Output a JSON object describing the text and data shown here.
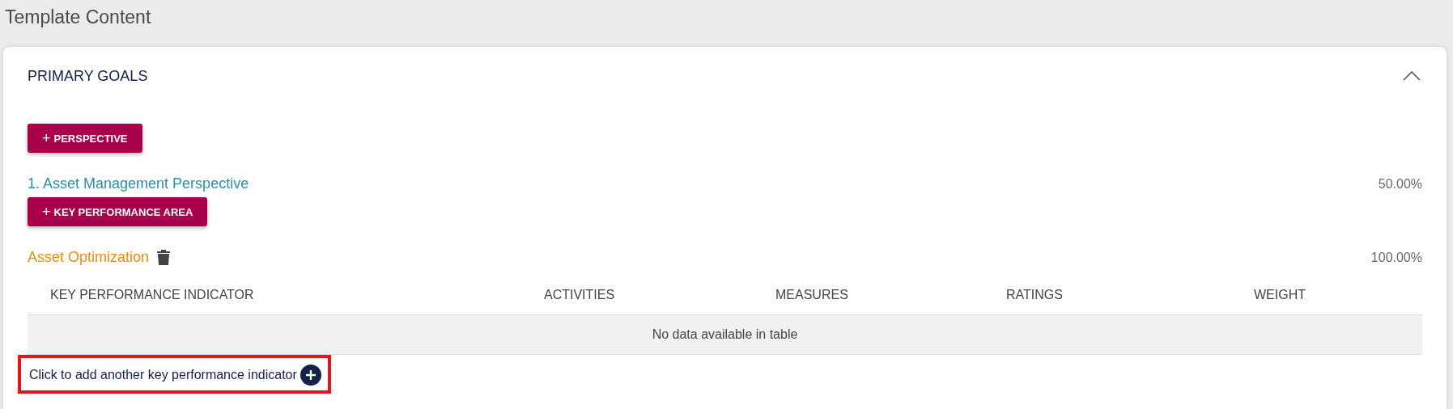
{
  "page_title": "Template Content",
  "section": {
    "title": "PRIMARY GOALS",
    "expanded": true,
    "add_perspective": {
      "icon": "+",
      "label": "PERSPECTIVE"
    },
    "perspective": {
      "title": "1. Asset Management Perspective",
      "weight": "50.00%",
      "add_kpa": {
        "icon": "+",
        "label": "KEY PERFORMANCE AREA"
      },
      "area": {
        "title": "Asset Optimization",
        "weight": "100.00%",
        "table": {
          "columns": [
            "KEY PERFORMANCE INDICATOR",
            "ACTIVITIES",
            "MEASURES",
            "RATINGS",
            "WEIGHT"
          ],
          "empty_message": "No data available in table"
        },
        "add_link": {
          "label": "Click to add another key performance indicator",
          "highlighted": true
        }
      }
    }
  }
}
